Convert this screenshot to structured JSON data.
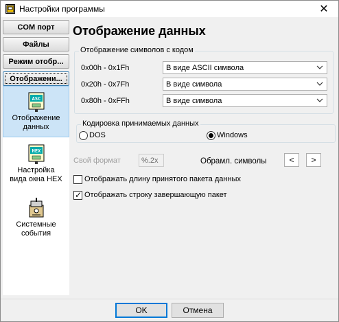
{
  "window": {
    "title": "Настройки программы",
    "close_glyph": "✕"
  },
  "nav": {
    "buttons": [
      {
        "label": "COM порт"
      },
      {
        "label": "Файлы"
      },
      {
        "label": "Режим отобр..."
      },
      {
        "label": "Отображени..."
      }
    ],
    "items": [
      {
        "label_line1": "Отображение",
        "label_line2": "данных",
        "icon": "asc-icon"
      },
      {
        "label_line1": "Настройка",
        "label_line2": "вида окна HEX",
        "icon": "hex-icon"
      },
      {
        "label_line1": "Системные",
        "label_line2": "события",
        "icon": "system-events-icon"
      }
    ]
  },
  "main": {
    "title": "Отображение данных",
    "symbols_group": {
      "legend": "Отображение символов с кодом",
      "rows": [
        {
          "range": "0x00h - 0x1Fh",
          "value": "В виде ASCII символа"
        },
        {
          "range": "0x20h - 0x7Fh",
          "value": "В виде символа"
        },
        {
          "range": "0x80h - 0xFFh",
          "value": "В виде символа"
        }
      ]
    },
    "encoding_group": {
      "legend": "Кодировка принимаемых данных",
      "options": [
        {
          "label": "DOS",
          "checked": false
        },
        {
          "label": "Windows",
          "checked": true
        }
      ]
    },
    "own_format": {
      "label": "Свой формат",
      "value": "%.2x"
    },
    "frame_symbols": {
      "label": "Обрамл. символы",
      "left": "<",
      "right": ">"
    },
    "checkboxes": [
      {
        "label": "Отображать длину принятого пакета данных",
        "checked": false
      },
      {
        "label": "Отображать строку завершающую пакет",
        "checked": true
      }
    ]
  },
  "footer": {
    "ok_label": "OK",
    "cancel_label": "Отмена"
  },
  "colors": {
    "accent": "#0078d7",
    "selected_bg": "#cce4f7"
  }
}
